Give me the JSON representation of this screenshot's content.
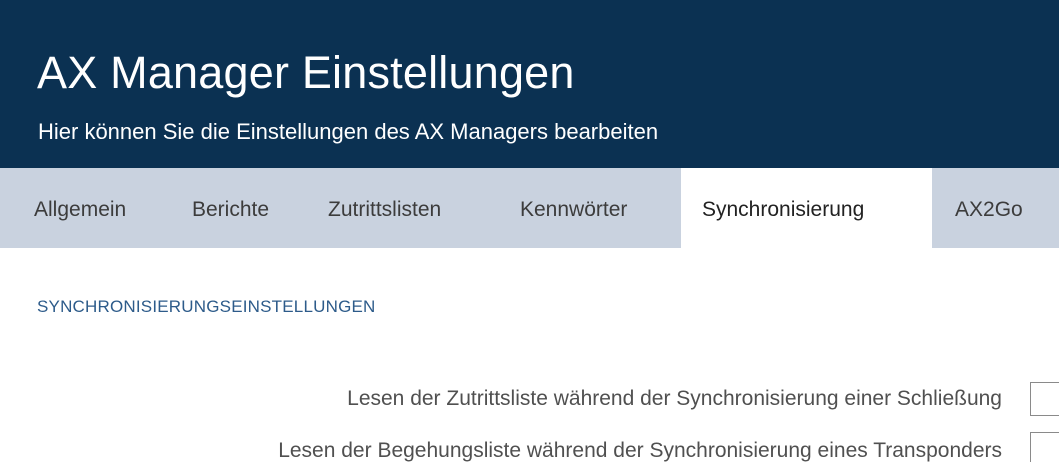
{
  "header": {
    "title": "AX Manager Einstellungen",
    "subtitle": "Hier können Sie die Einstellungen des AX Managers bearbeiten"
  },
  "tabs": [
    {
      "label": "Allgemein",
      "active": false
    },
    {
      "label": "Berichte",
      "active": false
    },
    {
      "label": "Zutrittslisten",
      "active": false
    },
    {
      "label": "Kennwörter",
      "active": false
    },
    {
      "label": "Synchronisierung",
      "active": true
    },
    {
      "label": "AX2Go",
      "active": false
    }
  ],
  "section": {
    "heading": "SYNCHRONISIERUNGSEINSTELLUNGEN",
    "settings": [
      {
        "label": "Lesen der Zutrittsliste während der Synchronisierung einer Schließung",
        "checked": false
      },
      {
        "label": "Lesen der Begehungsliste während der Synchronisierung eines Transponders",
        "checked": false
      }
    ]
  },
  "colors": {
    "header_bg": "#0b3152",
    "tabbar_bg": "#c9d2df",
    "section_heading": "#2d5b8a"
  }
}
